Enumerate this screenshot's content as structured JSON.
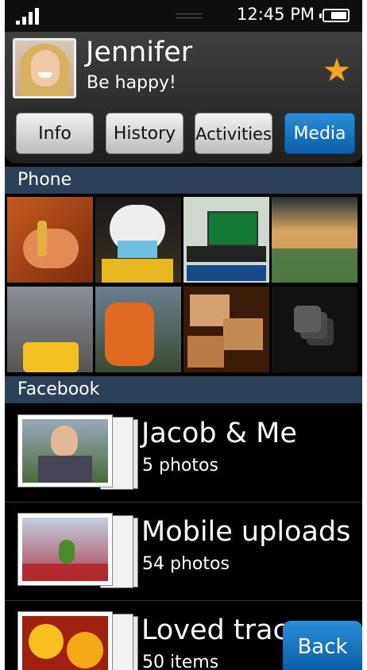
{
  "status_bar": {
    "time": "12:45 PM",
    "signal_icon": "signal-bars-icon",
    "battery_icon": "battery-icon"
  },
  "contact": {
    "name": "Jennifer",
    "status": "Be happy!",
    "favorite_icon": "star-icon",
    "favorite_color": "#f5a425"
  },
  "tabs": [
    {
      "label": "Info",
      "active": false
    },
    {
      "label": "History",
      "active": false
    },
    {
      "label": "Activities",
      "active": false
    },
    {
      "label": "Media",
      "active": true
    }
  ],
  "accent_color": "#1a78c2",
  "sections": {
    "phone": "Phone",
    "facebook": "Facebook"
  },
  "phone_photos": [
    "key-in-hand",
    "small-dog",
    "scoreboard",
    "basketball-court",
    "city-taxi",
    "number-9-sign",
    "bread-chunks",
    "more-stack-icon"
  ],
  "albums": [
    {
      "title": "Jacob & Me",
      "count": "5 photos"
    },
    {
      "title": "Mobile uploads",
      "count": "54 photos"
    },
    {
      "title": "Loved trac",
      "count": "50 items"
    }
  ],
  "back_label": "Back"
}
